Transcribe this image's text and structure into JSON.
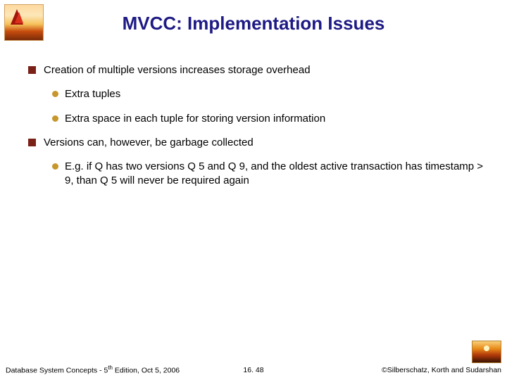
{
  "title": "MVCC: Implementation Issues",
  "bullets": {
    "b1": "Creation of multiple versions increases storage overhead",
    "b1a": "Extra tuples",
    "b1b": "Extra space in each tuple for storing version information",
    "b2": "Versions can, however, be garbage collected",
    "b2a": "E.g. if Q has two versions Q 5 and Q 9, and the oldest active transaction has timestamp > 9, than Q 5 will never be required again"
  },
  "footer": {
    "left_pre": "Database System Concepts - 5",
    "left_sup": "th",
    "left_post": " Edition, Oct 5, 2006",
    "center": "16. 48",
    "right": "©Silberschatz, Korth and Sudarshan"
  }
}
